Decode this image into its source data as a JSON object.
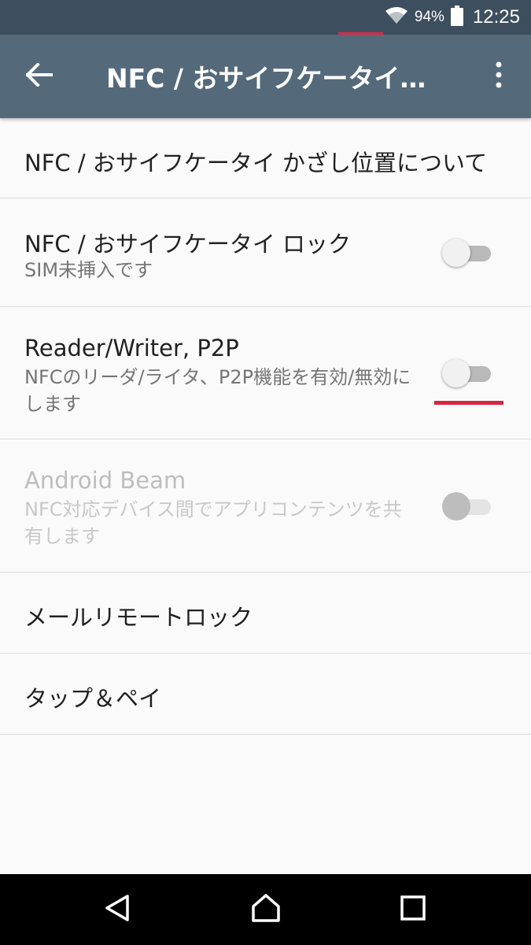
{
  "status_bar": {
    "battery_percent": "94%",
    "time": "12:25",
    "icons": [
      "wifi-icon",
      "battery-icon"
    ]
  },
  "toolbar": {
    "title": "NFC / おサイフケータイ…",
    "back_icon": "arrow-back-icon",
    "more_icon": "more-vertical-icon"
  },
  "settings": {
    "items": [
      {
        "title": "NFC / おサイフケータイ かざし位置について"
      },
      {
        "title": "NFC / おサイフケータイ ロック",
        "summary": "SIM未挿入です",
        "switch": "off"
      },
      {
        "title": "Reader/Writer, P2P",
        "summary": "NFCのリーダ/ライタ、P2P機能を有効/無効にします",
        "switch": "off"
      },
      {
        "title": "Android Beam",
        "summary": "NFC対応デバイス間でアプリコンテンツを共有します",
        "switch": "off",
        "enabled": false
      },
      {
        "title": "メールリモートロック"
      },
      {
        "title": "タップ＆ペイ"
      }
    ]
  },
  "nav_bar": {
    "buttons": [
      "back-triangle-icon",
      "home-icon",
      "recents-icon"
    ]
  },
  "colors": {
    "status_bar": "#3d4f5e",
    "toolbar": "#546a7b",
    "accent": "#d9253f",
    "background": "#fafafa"
  }
}
